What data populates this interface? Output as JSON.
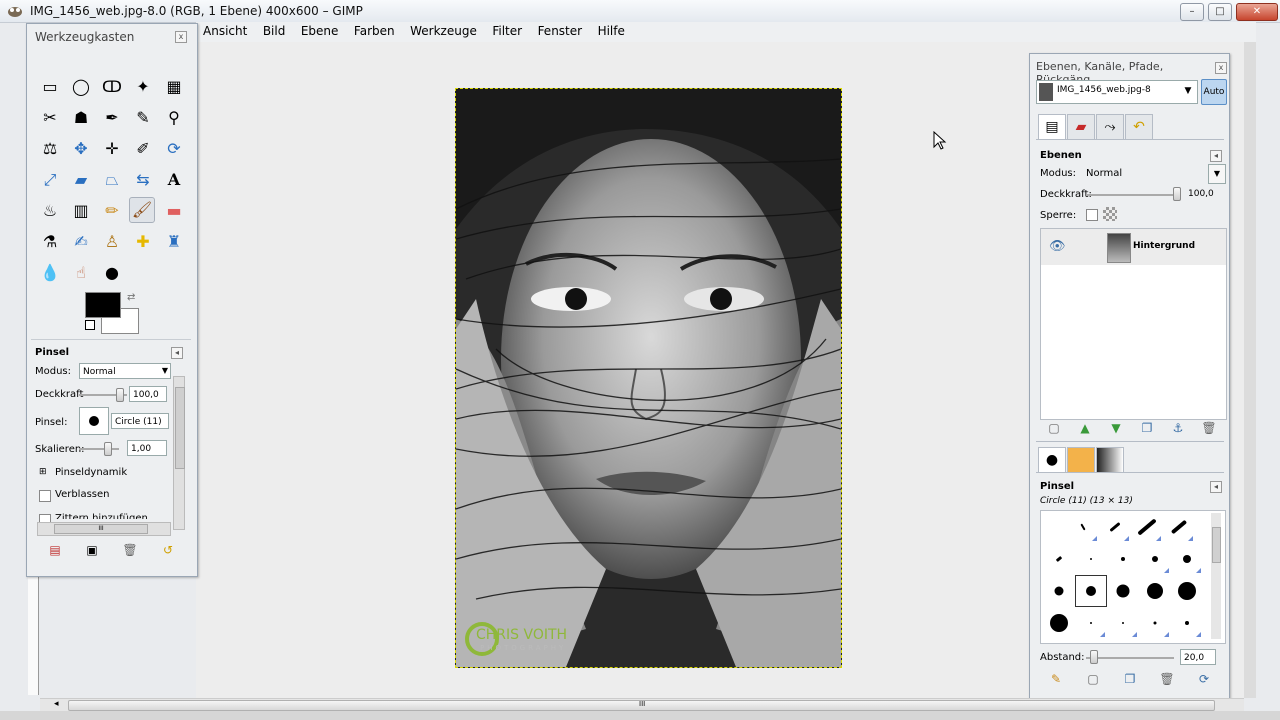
{
  "window": {
    "title": "IMG_1456_web.jpg-8.0 (RGB, 1 Ebene) 400x600 – GIMP",
    "minimize": "–",
    "maximize": "□",
    "close": "✕"
  },
  "menu": [
    "Ansicht",
    "Bild",
    "Ebene",
    "Farben",
    "Werkzeuge",
    "Filter",
    "Fenster",
    "Hilfe"
  ],
  "toolbox": {
    "title": "Werkzeugkasten",
    "tools": [
      "rect-select-icon",
      "ellipse-select-icon",
      "lasso-icon",
      "fuzzy-select-icon",
      "color-select-icon",
      "scissors-icon",
      "foreground-select-icon",
      "paths-icon",
      "color-picker-icon",
      "zoom-icon",
      "measure-icon",
      "move-icon",
      "align-icon",
      "crop-icon",
      "rotate-icon",
      "scale-icon",
      "shear-icon",
      "perspective-icon",
      "flip-icon",
      "text-icon",
      "bucket-fill-icon",
      "gradient-icon",
      "pencil-icon",
      "paintbrush-icon",
      "eraser-icon",
      "airbrush-icon",
      "ink-icon",
      "clone-icon",
      "heal-icon",
      "perspective-clone-icon",
      "blur-icon",
      "smudge-icon",
      "dodge-burn-icon"
    ],
    "tool_options": {
      "title": "Pinsel",
      "mode_label": "Modus:",
      "mode_value": "Normal",
      "opacity_label": "Deckkraft",
      "opacity_value": "100,0",
      "brush_label": "Pinsel:",
      "brush_value": "Circle (11)",
      "scale_label": "Skalieren:",
      "scale_value": "1,00",
      "dynamics_label": "Pinseldynamik",
      "fade_label": "Verblassen",
      "jitter_label": "Zittern hinzufügen",
      "scroll_mark": "III"
    }
  },
  "image": {
    "watermark_name": "CHRIS VOITH",
    "watermark_sub": "PHOTOGRAPHY"
  },
  "dock": {
    "title": "Ebenen, Kanäle, Pfade, Rückgäng...",
    "image_name": "IMG_1456_web.jpg-8",
    "auto_button": "Auto",
    "layers": {
      "title": "Ebenen",
      "mode_label": "Modus:",
      "mode_value": "Normal",
      "opacity_label": "Deckkraft:",
      "opacity_value": "100,0",
      "lock_label": "Sperre:",
      "layer_name": "Hintergrund"
    },
    "brushes": {
      "title": "Pinsel",
      "selected": "Circle (11) (13 × 13)",
      "spacing_label": "Abstand:",
      "spacing_value": "20,0"
    }
  },
  "statusbar": {
    "scroll_mark": "III"
  },
  "colors": {
    "accent": "#4a8fd8",
    "selection": "#d8d800",
    "panel": "#edeff1"
  }
}
